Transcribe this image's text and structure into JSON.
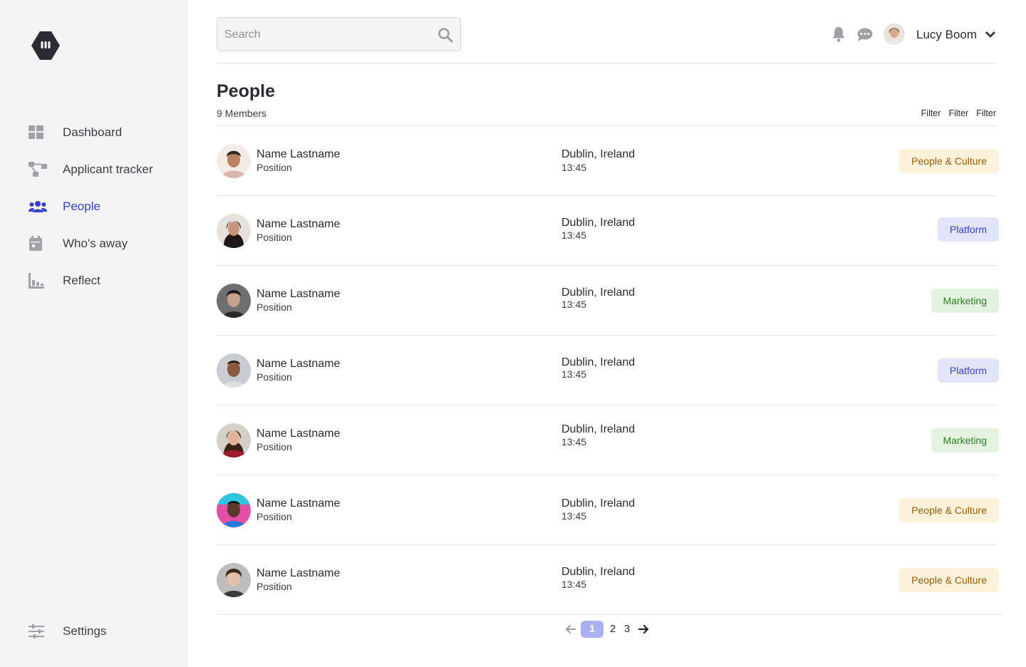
{
  "app": {
    "logo_name": "app-logo"
  },
  "sidebar": {
    "items": [
      {
        "label": "Dashboard",
        "icon": "dashboard-icon",
        "active": false
      },
      {
        "label": "Applicant tracker",
        "icon": "flow-icon",
        "active": false
      },
      {
        "label": "People",
        "icon": "people-icon",
        "active": true
      },
      {
        "label": "Who's away",
        "icon": "calendar-icon",
        "active": false
      },
      {
        "label": "Reflect",
        "icon": "chart-icon",
        "active": false
      }
    ],
    "settings_label": "Settings"
  },
  "header": {
    "search_placeholder": "Search",
    "user_name": "Lucy Boom"
  },
  "page": {
    "title": "People",
    "member_count": "9 Members",
    "filters": [
      "Filter",
      "Filter",
      "Filter"
    ]
  },
  "people": [
    {
      "name": "Name Lastname",
      "position": "Position",
      "location": "Dublin, Ireland",
      "time": "13:45",
      "team": "People & Culture",
      "team_style": "pc"
    },
    {
      "name": "Name Lastname",
      "position": "Position",
      "location": "Dublin, Ireland",
      "time": "13:45",
      "team": "Platform",
      "team_style": "pl"
    },
    {
      "name": "Name Lastname",
      "position": "Position",
      "location": "Dublin, Ireland",
      "time": "13:45",
      "team": "Marketing",
      "team_style": "mk"
    },
    {
      "name": "Name Lastname",
      "position": "Position",
      "location": "Dublin, Ireland",
      "time": "13:45",
      "team": "Platform",
      "team_style": "pl"
    },
    {
      "name": "Name Lastname",
      "position": "Position",
      "location": "Dublin, Ireland",
      "time": "13:45",
      "team": "Marketing",
      "team_style": "mk"
    },
    {
      "name": "Name Lastname",
      "position": "Position",
      "location": "Dublin, Ireland",
      "time": "13:45",
      "team": "People & Culture",
      "team_style": "pc"
    },
    {
      "name": "Name Lastname",
      "position": "Position",
      "location": "Dublin, Ireland",
      "time": "13:45",
      "team": "People & Culture",
      "team_style": "pc"
    }
  ],
  "pagination": {
    "pages": [
      "1",
      "2",
      "3"
    ],
    "current": "1"
  },
  "colors": {
    "accent": "#3640c8",
    "sidebar_bg": "#f4f4f5",
    "tag_people_culture": "#fdf2d9",
    "tag_platform": "#e2e4f9",
    "tag_marketing": "#e3f3df"
  }
}
